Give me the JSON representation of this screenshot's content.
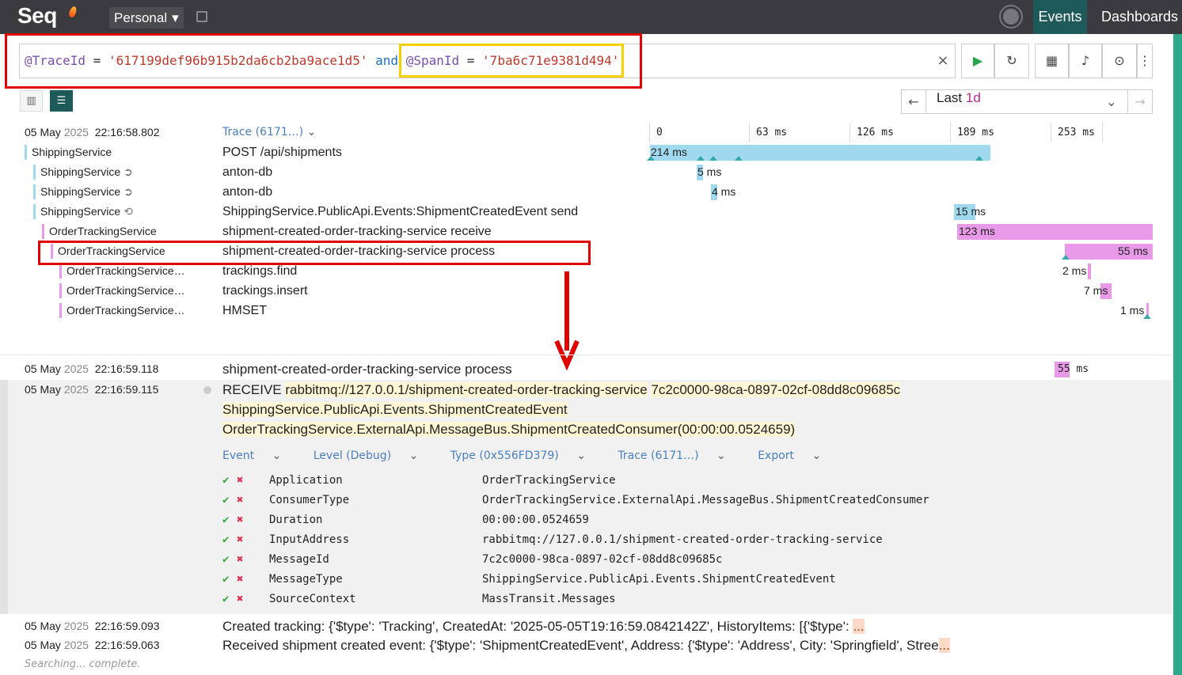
{
  "topbar": {
    "app_name": "Seq",
    "workspace": "Personal",
    "nav_events": "Events",
    "nav_dashboards": "Dashboards"
  },
  "query": {
    "p1": "@TraceId",
    "op1": "=",
    "s1": "'617199def96b915b2da6cb2ba9ace1d5'",
    "kw": "and",
    "p2": "@SpanId",
    "op2": "=",
    "s2": "'7ba6c71e9381d494'"
  },
  "range": {
    "prefix": "Last",
    "value": "1d"
  },
  "trace": {
    "header_ts_date": "05 May",
    "header_ts_year": "2025",
    "header_ts_time": "22:16:58.802",
    "header_label": "Trace (6171…)",
    "axis": [
      "0",
      "63 ms",
      "126 ms",
      "189 ms",
      "253 ms"
    ],
    "spans": [
      {
        "service": "ShippingService",
        "name": "POST /api/shipments",
        "duration": "214 ms"
      },
      {
        "service": "ShippingService",
        "name": "anton-db",
        "duration": "5 ms"
      },
      {
        "service": "ShippingService",
        "name": "anton-db",
        "duration": "4 ms"
      },
      {
        "service": "ShippingService",
        "name": "ShippingService.PublicApi.Events:ShipmentCreatedEvent send",
        "duration": "15 ms"
      },
      {
        "service": "OrderTrackingService",
        "name": "shipment-created-order-tracking-service receive",
        "duration": "123 ms"
      },
      {
        "service": "OrderTrackingService",
        "name": "shipment-created-order-tracking-service process",
        "duration": "55 ms"
      },
      {
        "service": "OrderTrackingService…",
        "name": "trackings.find",
        "duration": "2 ms"
      },
      {
        "service": "OrderTrackingService…",
        "name": "trackings.insert",
        "duration": "7 ms"
      },
      {
        "service": "OrderTrackingService…",
        "name": "HMSET",
        "duration": "1 ms"
      }
    ]
  },
  "events": {
    "e1": {
      "date": "05 May",
      "year": "2025",
      "time": "22:16:59.118",
      "message": "shipment-created-order-tracking-service process",
      "duration_value": "55",
      "duration_unit": "ms"
    },
    "e2": {
      "date": "05 May",
      "year": "2025",
      "time": "22:16:59.115",
      "line1a": "RECEIVE",
      "line1b": "rabbitmq://127.0.0.1/shipment-created-order-tracking-service",
      "line1c": "7c2c0000-98ca-0897-02cf-08dd8c09685c",
      "line2": "ShippingService.PublicApi.Events.ShipmentCreatedEvent",
      "line3a": "OrderTrackingService.ExternalApi.MessageBus.ShipmentCreatedConsumer",
      "line3b": "(00:00:00.0524659)",
      "tabs": [
        "Event",
        "Level (Debug)",
        "Type (0x556FD379)",
        "Trace (6171…)",
        "Export"
      ],
      "props": [
        {
          "k": "Application",
          "v": "OrderTrackingService"
        },
        {
          "k": "ConsumerType",
          "v": "OrderTrackingService.ExternalApi.MessageBus.ShipmentCreatedConsumer"
        },
        {
          "k": "Duration",
          "v": "00:00:00.0524659"
        },
        {
          "k": "InputAddress",
          "v": "rabbitmq://127.0.0.1/shipment-created-order-tracking-service"
        },
        {
          "k": "MessageId",
          "v": "7c2c0000-98ca-0897-02cf-08dd8c09685c"
        },
        {
          "k": "MessageType",
          "v": "ShippingService.PublicApi.Events.ShipmentCreatedEvent"
        },
        {
          "k": "SourceContext",
          "v": "MassTransit.Messages"
        }
      ]
    },
    "e3": {
      "date": "05 May",
      "year": "2025",
      "time": "22:16:59.093",
      "message": "Created tracking: {'$type': 'Tracking', CreatedAt: '2025-05-05T19:16:59.0842142Z', HistoryItems: [{'$type': ",
      "ellipsis": "..."
    },
    "e4": {
      "date": "05 May",
      "year": "2025",
      "time": "22:16:59.063",
      "message": "Received shipment created event: {'$type': 'ShipmentCreatedEvent', Address: {'$type': 'Address', City: 'Springfield', Stree",
      "ellipsis": "..."
    }
  },
  "status": "Searching... complete."
}
